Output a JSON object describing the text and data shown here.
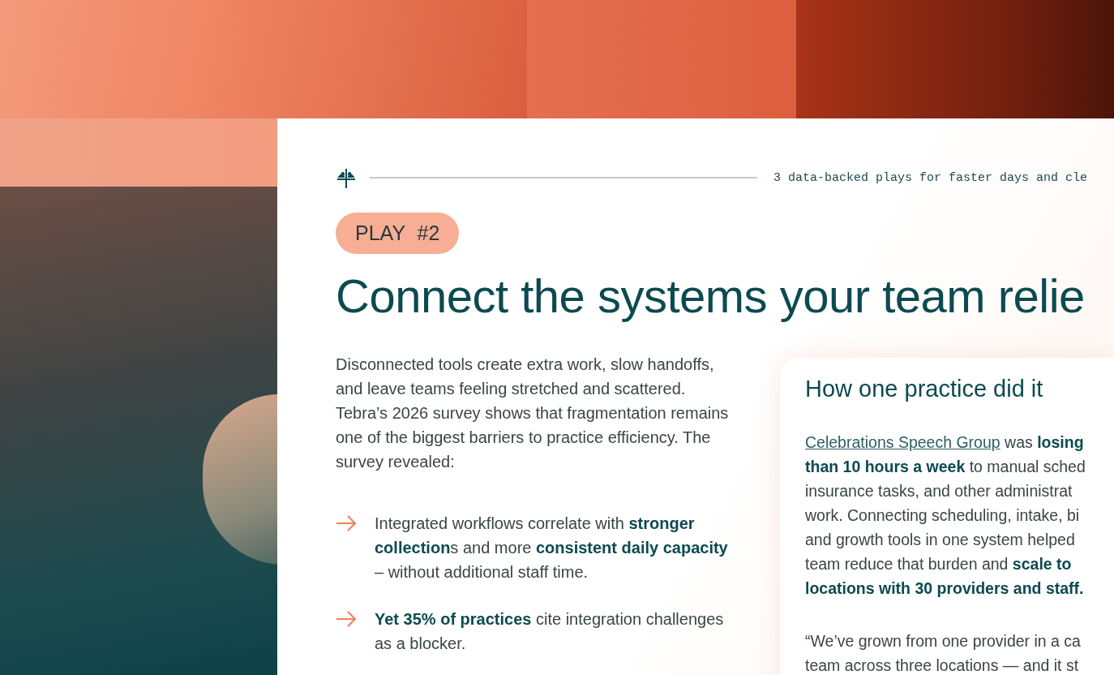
{
  "header": {
    "tagline": "3 data-backed plays for faster days and cle"
  },
  "badge": "PLAY #2",
  "title": "Connect the systems your team relie",
  "intro": "Disconnected tools create extra work, slow handoffs, and leave teams feeling stretched and scattered. Tebra’s 2026 survey shows that fragmentation remains one of the biggest barriers to practice efficiency. The survey revealed:",
  "bullets": [
    {
      "text": "Integrated workflows correlate with **stronger collection**s and more **consistent daily capacity** – without additional staff time."
    },
    {
      "text": "**Yet 35% of practices** cite integration challenges as a blocker."
    }
  ],
  "case_study": {
    "heading": "How one practice did it",
    "link": "Celebrations Speech Group",
    "lines": [
      " was **losing**",
      "**than 10 hours a week** to manual sched",
      "insurance tasks, and other administrat",
      "work. Connecting scheduling, intake, bi",
      "and growth tools in one system helped",
      "team reduce that burden and **scale to**",
      "**locations with 30 providers and staff.**"
    ],
    "quote_lines": [
      "“We’ve grown from one provider in a ca",
      "team across three locations — and it st"
    ]
  }
}
